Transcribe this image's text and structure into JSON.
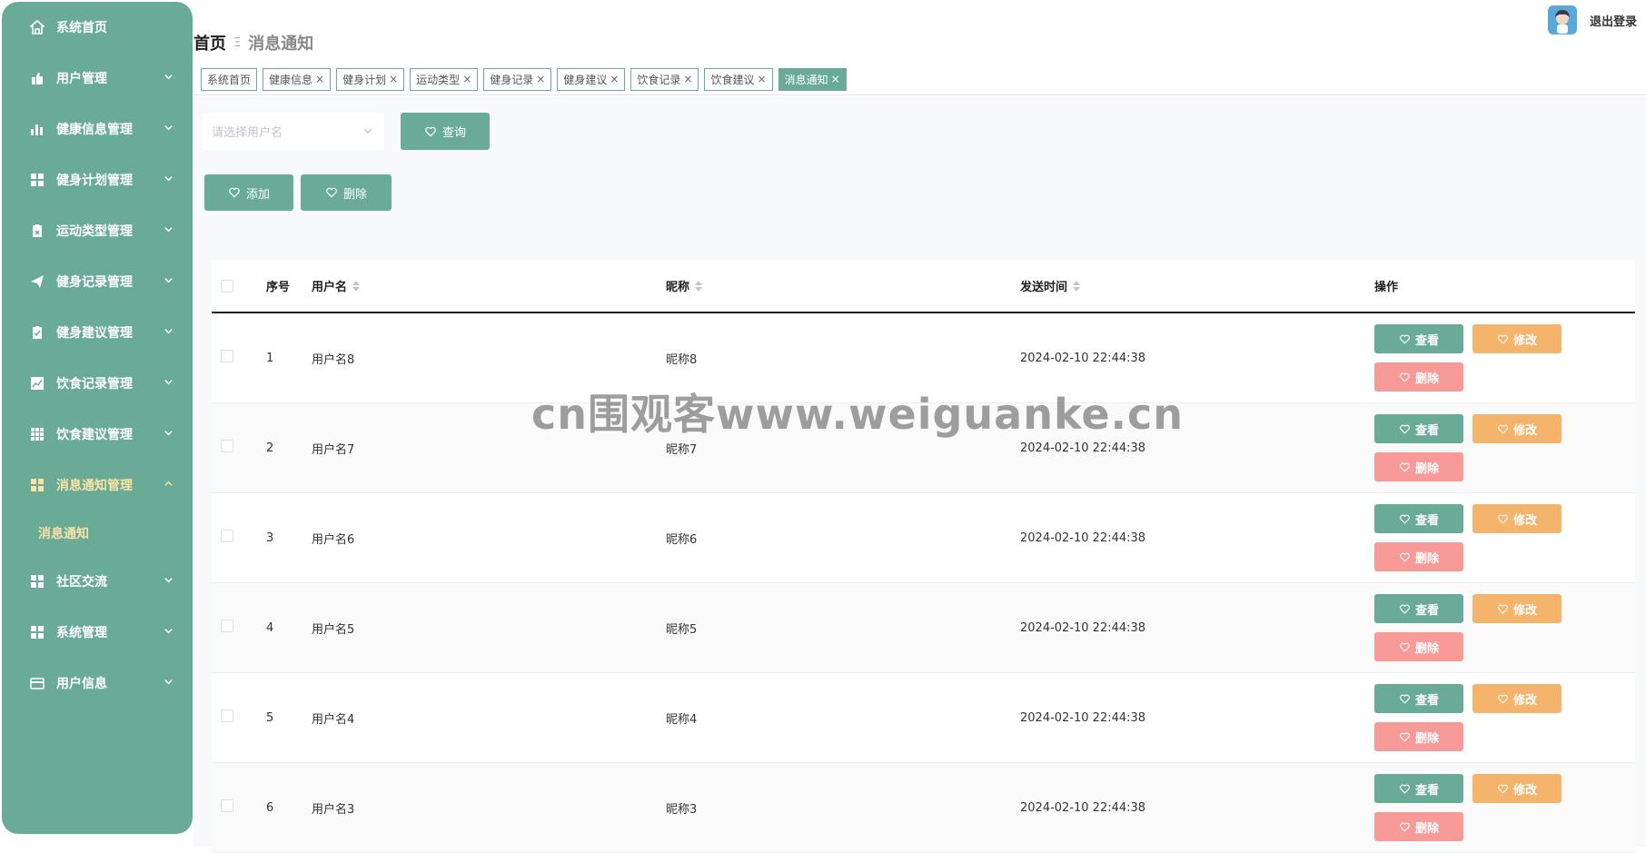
{
  "sidebar": {
    "items": [
      {
        "label": "系统首页",
        "icon": "home-icon",
        "chevron": false
      },
      {
        "label": "用户管理",
        "icon": "user-manage-icon",
        "chevron": true
      },
      {
        "label": "健康信息管理",
        "icon": "bar-chart-icon",
        "chevron": true
      },
      {
        "label": "健身计划管理",
        "icon": "grid-icon",
        "chevron": true
      },
      {
        "label": "运动类型管理",
        "icon": "clipboard-icon",
        "chevron": true
      },
      {
        "label": "健身记录管理",
        "icon": "send-icon",
        "chevron": true
      },
      {
        "label": "健身建议管理",
        "icon": "clipboard-check-icon",
        "chevron": true
      },
      {
        "label": "饮食记录管理",
        "icon": "line-chart-icon",
        "chevron": true
      },
      {
        "label": "饮食建议管理",
        "icon": "table-icon",
        "chevron": true
      },
      {
        "label": "消息通知管理",
        "icon": "grid-icon",
        "chevron": true,
        "active": true
      },
      {
        "label": "社区交流",
        "icon": "grid-icon",
        "chevron": true
      },
      {
        "label": "系统管理",
        "icon": "grid-icon",
        "chevron": true
      },
      {
        "label": "用户信息",
        "icon": "card-icon",
        "chevron": true
      }
    ],
    "submenu": {
      "label": "消息通知"
    }
  },
  "header": {
    "breadcrumb_home": "首页",
    "breadcrumb_sep": "Ξ",
    "breadcrumb_current": "消息通知",
    "logout": "退出登录"
  },
  "tabs": [
    {
      "label": "系统首页",
      "closable": false
    },
    {
      "label": "健康信息",
      "closable": true
    },
    {
      "label": "健身计划",
      "closable": true
    },
    {
      "label": "运动类型",
      "closable": true
    },
    {
      "label": "健身记录",
      "closable": true
    },
    {
      "label": "健身建议",
      "closable": true
    },
    {
      "label": "饮食记录",
      "closable": true
    },
    {
      "label": "饮食建议",
      "closable": true
    },
    {
      "label": "消息通知",
      "closable": true,
      "active": true
    }
  ],
  "search": {
    "placeholder": "请选择用户名",
    "query_label": "查询"
  },
  "actions": {
    "add_label": "添加",
    "delete_label": "删除"
  },
  "table": {
    "columns": {
      "index": "序号",
      "username": "用户名",
      "nickname": "昵称",
      "send_time": "发送时间",
      "ops": "操作"
    },
    "rows": [
      {
        "index": "1",
        "username": "用户名8",
        "nickname": "昵称8",
        "send_time": "2024-02-10 22:44:38"
      },
      {
        "index": "2",
        "username": "用户名7",
        "nickname": "昵称7",
        "send_time": "2024-02-10 22:44:38"
      },
      {
        "index": "3",
        "username": "用户名6",
        "nickname": "昵称6",
        "send_time": "2024-02-10 22:44:38"
      },
      {
        "index": "4",
        "username": "用户名5",
        "nickname": "昵称5",
        "send_time": "2024-02-10 22:44:38"
      },
      {
        "index": "5",
        "username": "用户名4",
        "nickname": "昵称4",
        "send_time": "2024-02-10 22:44:38"
      },
      {
        "index": "6",
        "username": "用户名3",
        "nickname": "昵称3",
        "send_time": "2024-02-10 22:44:38"
      }
    ],
    "op_labels": {
      "view": "查看",
      "edit": "修改",
      "delete": "删除"
    }
  },
  "watermark": "cn围观客www.weiguanke.cn",
  "colors": {
    "accent": "#6aab98",
    "active_text": "#f6e3a5",
    "edit": "#f4b46c",
    "delete": "#f79a98"
  }
}
